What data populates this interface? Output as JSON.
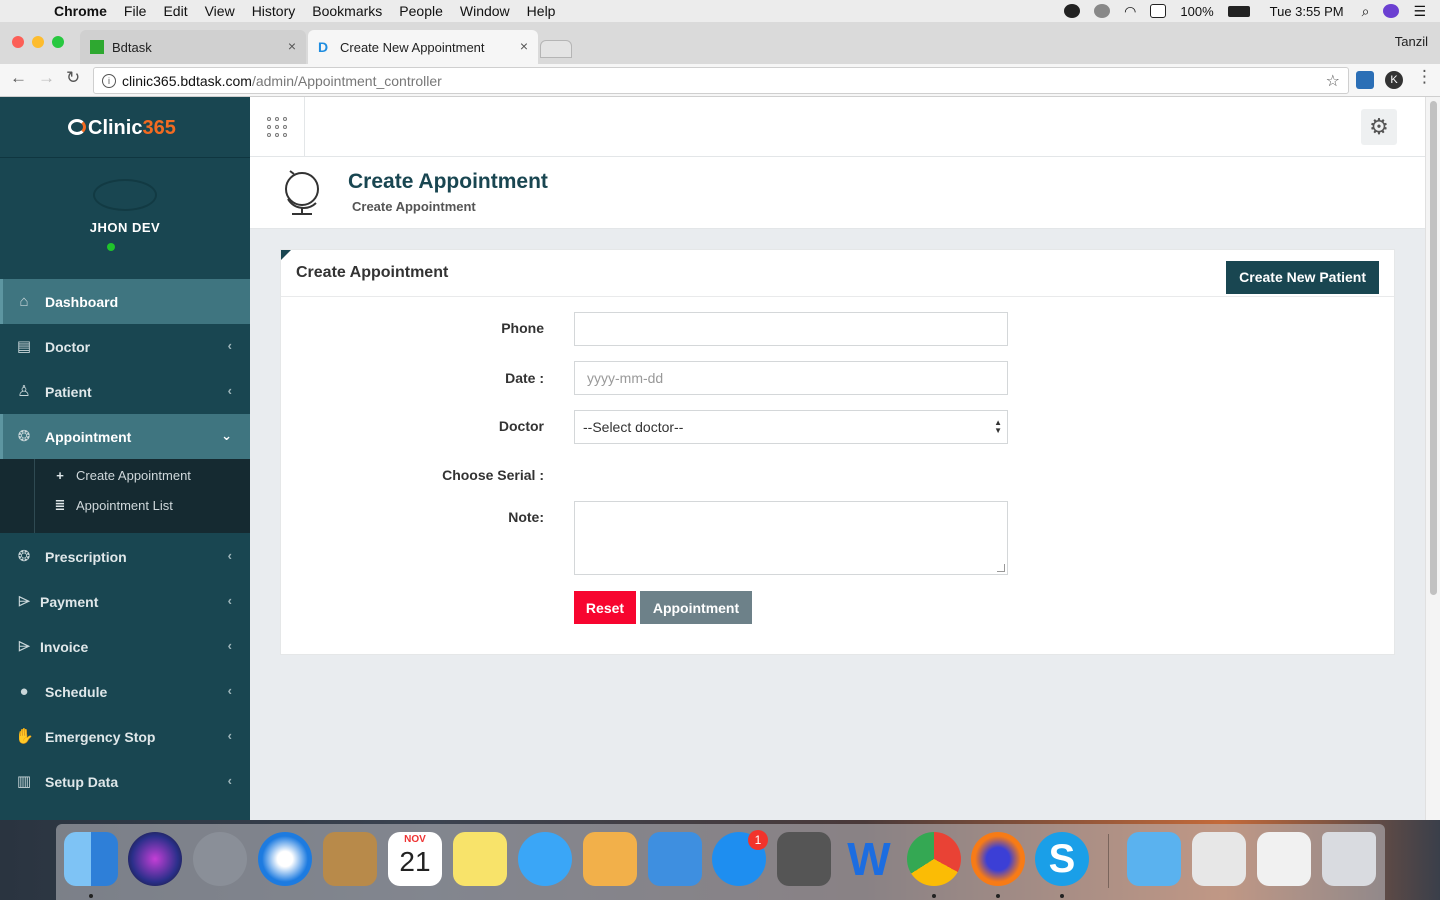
{
  "menubar": {
    "app": "Chrome",
    "items": [
      "File",
      "Edit",
      "View",
      "History",
      "Bookmarks",
      "People",
      "Window",
      "Help"
    ],
    "battery": "100%",
    "clock": "Tue 3:55 PM"
  },
  "browser": {
    "tabs": [
      {
        "title": "Bdtask",
        "favicon_color": "#2ea830"
      },
      {
        "title": "Create New Appointment",
        "favicon_letter": "D",
        "favicon_color": "#1f8de0"
      }
    ],
    "profile": "Tanzil",
    "url_host": "clinic365.bdtask.com",
    "url_path": "/admin/Appointment_controller",
    "account_letter": "K"
  },
  "brand": {
    "name": "Clinic",
    "number": "365",
    "accent": "#f36b21",
    "sidebar_bg": "#194651"
  },
  "user": {
    "name": "JHON DEV",
    "status_color": "#1fc42b"
  },
  "sidebar": {
    "items": [
      {
        "label": "Dashboard",
        "icon": "home-icon"
      },
      {
        "label": "Doctor",
        "icon": "document-icon"
      },
      {
        "label": "Patient",
        "icon": "person-icon"
      },
      {
        "label": "Appointment",
        "icon": "cube-icon"
      },
      {
        "label": "Prescription",
        "icon": "cube-icon"
      },
      {
        "label": "Payment",
        "icon": "tag-icon"
      },
      {
        "label": "Invoice",
        "icon": "tag-icon"
      },
      {
        "label": "Schedule",
        "icon": "chat-icon"
      },
      {
        "label": "Emergency Stop",
        "icon": "hand-icon"
      },
      {
        "label": "Setup Data",
        "icon": "bar-chart-icon"
      }
    ],
    "submenu": [
      {
        "label": "Create Appointment",
        "icon": "plus-icon"
      },
      {
        "label": "Appointment List",
        "icon": "list-icon"
      }
    ]
  },
  "header": {
    "title": "Create Appointment",
    "subtitle": "Create Appointment"
  },
  "panel": {
    "title": "Create Appointment",
    "new_patient_button": "Create New Patient"
  },
  "form": {
    "phone_label": "Phone",
    "phone_value": "",
    "date_label": "Date :",
    "date_placeholder": "yyyy-mm-dd",
    "doctor_label": "Doctor",
    "doctor_selected": "--Select doctor--",
    "serial_label": "Choose Serial :",
    "note_label": "Note:",
    "reset_button": "Reset",
    "submit_button": "Appointment",
    "reset_color": "#f7052f",
    "submit_color": "#6d8189"
  },
  "dock": {
    "calendar_month": "NOV",
    "calendar_day": "21",
    "appstore_badge": "1"
  }
}
